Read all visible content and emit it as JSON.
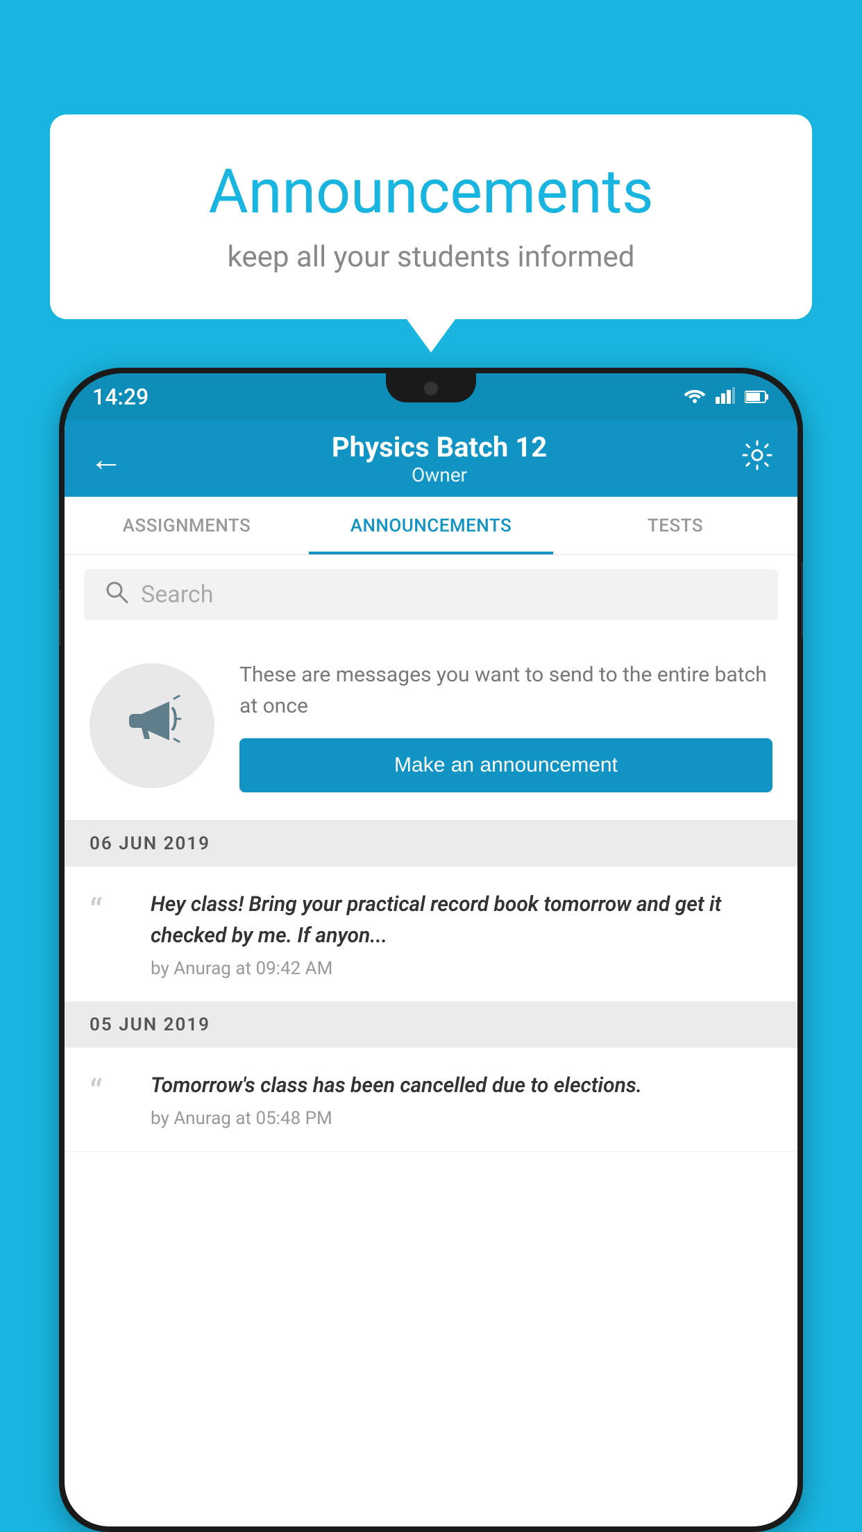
{
  "page": {
    "background_color": "#19b5e0"
  },
  "speech_bubble": {
    "title": "Announcements",
    "subtitle": "keep all your students informed"
  },
  "phone": {
    "status_bar": {
      "time": "14:29",
      "wifi": "▲",
      "signal": "▲",
      "battery": "▮"
    },
    "top_bar": {
      "back_label": "←",
      "title": "Physics Batch 12",
      "subtitle": "Owner",
      "gear_label": "⚙"
    },
    "tabs": [
      {
        "label": "ASSIGNMENTS",
        "active": false
      },
      {
        "label": "ANNOUNCEMENTS",
        "active": true
      },
      {
        "label": "TESTS",
        "active": false
      }
    ],
    "search": {
      "placeholder": "Search"
    },
    "announcement_prompt": {
      "description": "These are messages you want to send to the entire batch at once",
      "button_label": "Make an announcement"
    },
    "announcements": [
      {
        "date": "06  JUN  2019",
        "items": [
          {
            "text": "Hey class! Bring your practical record book tomorrow and get it checked by me. If anyon...",
            "meta": "by Anurag at 09:42 AM"
          }
        ]
      },
      {
        "date": "05  JUN  2019",
        "items": [
          {
            "text": "Tomorrow's class has been cancelled due to elections.",
            "meta": "by Anurag at 05:48 PM"
          }
        ]
      }
    ]
  }
}
